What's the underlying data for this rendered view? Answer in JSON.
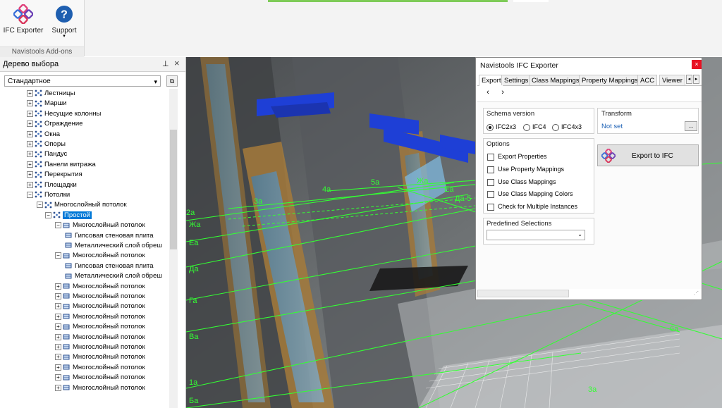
{
  "ribbon": {
    "buttons": [
      {
        "label": "IFC Exporter",
        "icon": "ifc-exporter-logo-icon"
      },
      {
        "label": "Support",
        "icon": "help-question-icon"
      }
    ],
    "group_label": "Navistools Add-ons"
  },
  "tree": {
    "title": "Дерево выбора",
    "dropdown_value": "Стандартное",
    "items": [
      {
        "label": "Лестницы",
        "indent": 1,
        "exp": "+"
      },
      {
        "label": "Марши",
        "indent": 1,
        "exp": "+"
      },
      {
        "label": "Несущие колонны",
        "indent": 1,
        "exp": "+"
      },
      {
        "label": "Ограждение",
        "indent": 1,
        "exp": "+"
      },
      {
        "label": "Окна",
        "indent": 1,
        "exp": "+"
      },
      {
        "label": "Опоры",
        "indent": 1,
        "exp": "+"
      },
      {
        "label": "Пандус",
        "indent": 1,
        "exp": "+"
      },
      {
        "label": "Панели витража",
        "indent": 1,
        "exp": "+"
      },
      {
        "label": "Перекрытия",
        "indent": 1,
        "exp": "+"
      },
      {
        "label": "Площадки",
        "indent": 1,
        "exp": "+"
      },
      {
        "label": "Потолки",
        "indent": 1,
        "exp": "-"
      },
      {
        "label": "Многослойный потолок",
        "indent": 2,
        "exp": "-"
      },
      {
        "label": "Простой",
        "indent": 3,
        "exp": "-",
        "selected": true
      },
      {
        "label": "Многослойный потолок",
        "indent": 4,
        "exp": "-"
      },
      {
        "label": "Гипсовая стеновая плита",
        "indent": 5,
        "exp": ""
      },
      {
        "label": "Металлический слой обреш",
        "indent": 5,
        "exp": ""
      },
      {
        "label": "Многослойный потолок",
        "indent": 4,
        "exp": "-"
      },
      {
        "label": "Гипсовая стеновая плита",
        "indent": 5,
        "exp": ""
      },
      {
        "label": "Металлический слой обреш",
        "indent": 5,
        "exp": ""
      },
      {
        "label": "Многослойный потолок",
        "indent": 4,
        "exp": "+"
      },
      {
        "label": "Многослойный потолок",
        "indent": 4,
        "exp": "+"
      },
      {
        "label": "Многослойный потолок",
        "indent": 4,
        "exp": "+"
      },
      {
        "label": "Многослойный потолок",
        "indent": 4,
        "exp": "+"
      },
      {
        "label": "Многослойный потолок",
        "indent": 4,
        "exp": "+"
      },
      {
        "label": "Многослойный потолок",
        "indent": 4,
        "exp": "+"
      },
      {
        "label": "Многослойный потолок",
        "indent": 4,
        "exp": "+"
      },
      {
        "label": "Многослойный потолок",
        "indent": 4,
        "exp": "+"
      },
      {
        "label": "Многослойный потолок",
        "indent": 4,
        "exp": "+"
      },
      {
        "label": "Многослойный потолок",
        "indent": 4,
        "exp": "+"
      },
      {
        "label": "Многослойный потолок",
        "indent": 4,
        "exp": "+"
      }
    ]
  },
  "viewport": {
    "grid_labels": [
      "2a",
      "Жа",
      "Еа",
      "Да",
      "Га",
      "Ва",
      "1a",
      "Ба",
      "3a",
      "4a",
      "5a",
      "Жа",
      "Еа",
      "Да-5",
      "3a",
      "6a"
    ]
  },
  "dialog": {
    "title": "Navistools IFC Exporter",
    "close_glyph": "×",
    "tabs": [
      "Export",
      "Settings",
      "Class Mappings",
      "Property Mappings",
      "ACC",
      "Viewer"
    ],
    "active_tab": "Export",
    "nav_back": "‹",
    "nav_forward": "›",
    "schema": {
      "title": "Schema version",
      "options": [
        "IFC2x3",
        "IFC4",
        "IFC4x3"
      ],
      "selected": "IFC2x3"
    },
    "transform": {
      "title": "Transform",
      "value": "Not set",
      "browse": "..."
    },
    "options": {
      "title": "Options",
      "items": [
        "Export Properties",
        "Use Property Mappings",
        "Use Class Mappings",
        "Use Class Mapping Colors",
        "Check for Multiple Instances"
      ]
    },
    "export_button": "Export to IFC",
    "predefined": {
      "title": "Predefined Selections",
      "value": ""
    }
  },
  "colors": {
    "grid_green": "#33ff33",
    "selection_blue": "#0078d7",
    "close_red": "#e81123"
  }
}
